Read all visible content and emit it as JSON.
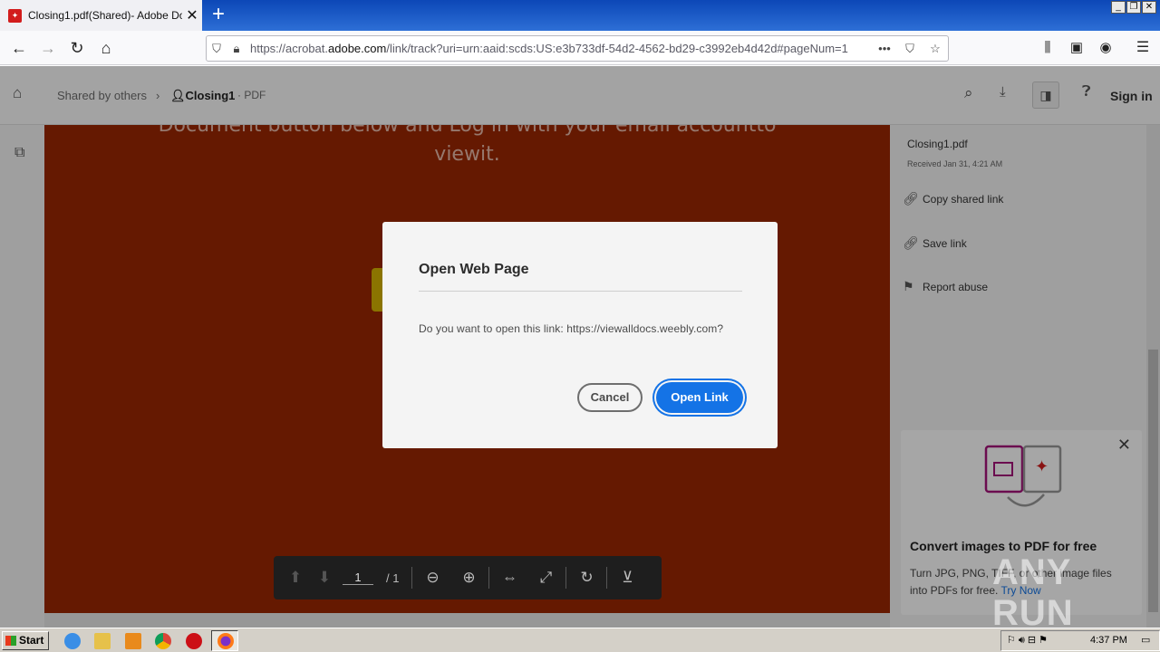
{
  "browser": {
    "tab_title": "Closing1.pdf(Shared)- Adobe Doc",
    "tab_close": "✕",
    "new_tab": "+",
    "url_prefix": "https://acrobat.",
    "url_domain": "adobe.com",
    "url_suffix": "/link/track?uri=urn:aaid:scds:US:e3b733df-54d2-4562-bd29-c3992eb4d42d#pageNum=1"
  },
  "acrobat": {
    "crumb_shared": "Shared by others",
    "crumb_file": "Closing1",
    "crumb_type": "· PDF",
    "sign_in": "Sign in"
  },
  "document": {
    "line1": "Document button below and Log in with your email accountto",
    "line2": "viewit."
  },
  "dialog": {
    "title": "Open Web Page",
    "message": "Do you want to open this link: https://viewalldocs.weebly.com?",
    "cancel_label": "Cancel",
    "open_label": "Open Link"
  },
  "page_toolbar": {
    "current_page": "1",
    "total_pages": "/ 1"
  },
  "right_panel": {
    "file_name": "Closing1.pdf",
    "received": "Received Jan 31, 4:21 AM",
    "copy_link": "Copy shared link",
    "save_link": "Save link",
    "report_abuse": "Report abuse",
    "promo_title": "Convert images to PDF for free",
    "promo_body": "Turn JPG, PNG, TIFF, or other image files into PDFs for free.",
    "promo_link": "Try Now"
  },
  "taskbar": {
    "start_label": "Start",
    "clock": "4:37 PM"
  },
  "watermark": "ANY RUN",
  "colors": {
    "document_bg": "#9b2702",
    "primary_button": "#1473e6"
  }
}
